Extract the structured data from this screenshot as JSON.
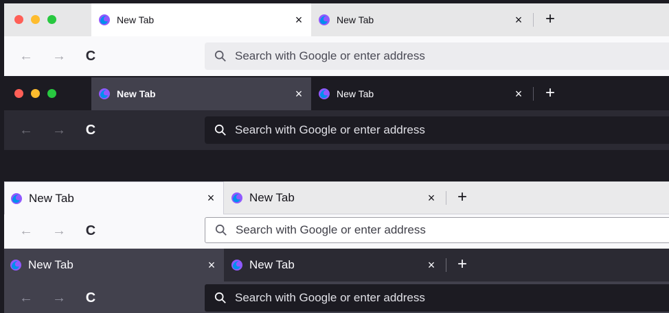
{
  "tab_label": "New Tab",
  "close_glyph": "×",
  "new_tab_glyph": "+",
  "back_glyph": "←",
  "forward_glyph": "→",
  "reload_glyph": "C",
  "url_placeholder": "Search with Google or enter address",
  "icons": {
    "traffic_lights": [
      "close-light",
      "minimize-light",
      "zoom-light"
    ],
    "tab_icon": "firefox-icon",
    "search_icon": "search-icon"
  },
  "colors": {
    "traffic_red": "#ff5f57",
    "traffic_yellow": "#febc2e",
    "traffic_green": "#28c840",
    "firefox_purple": "#9059ff",
    "firefox_blue": "#0090ed"
  }
}
